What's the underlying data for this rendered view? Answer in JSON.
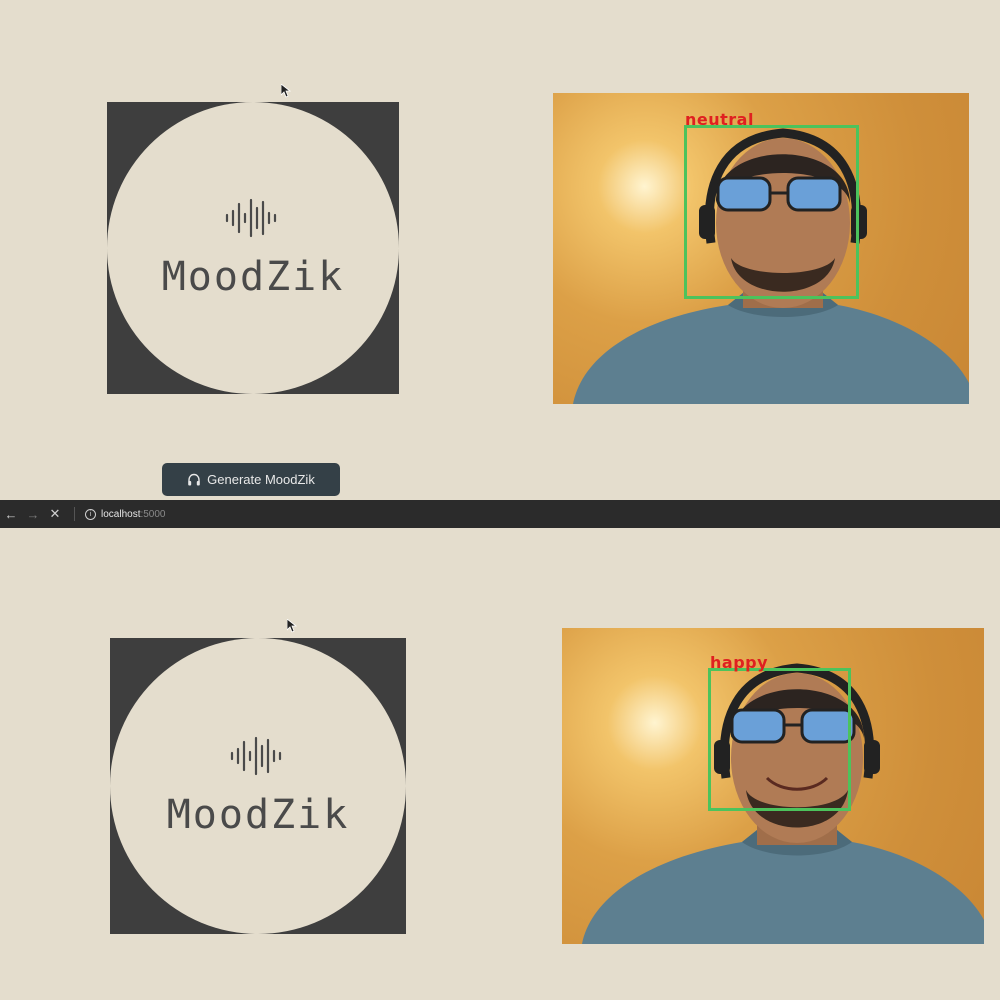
{
  "top": {
    "logo": {
      "name": "MoodZik"
    },
    "webcam": {
      "emotion": "neutral"
    },
    "generate_button": {
      "label": "Generate MoodZik",
      "icon": "headphones-icon"
    }
  },
  "browser": {
    "url_host": "localhost",
    "url_port": ":5000",
    "back_icon": "arrow-left-icon",
    "forward_icon": "arrow-right-icon",
    "stop_icon": "close-icon"
  },
  "bottom": {
    "logo": {
      "name": "MoodZik"
    },
    "webcam": {
      "emotion": "happy"
    }
  },
  "colors": {
    "background": "#e4ddcd",
    "logo_square": "#3e3e3e",
    "button_bg": "#344047",
    "face_box": "#4cc35c",
    "emotion_label": "#e02020"
  }
}
